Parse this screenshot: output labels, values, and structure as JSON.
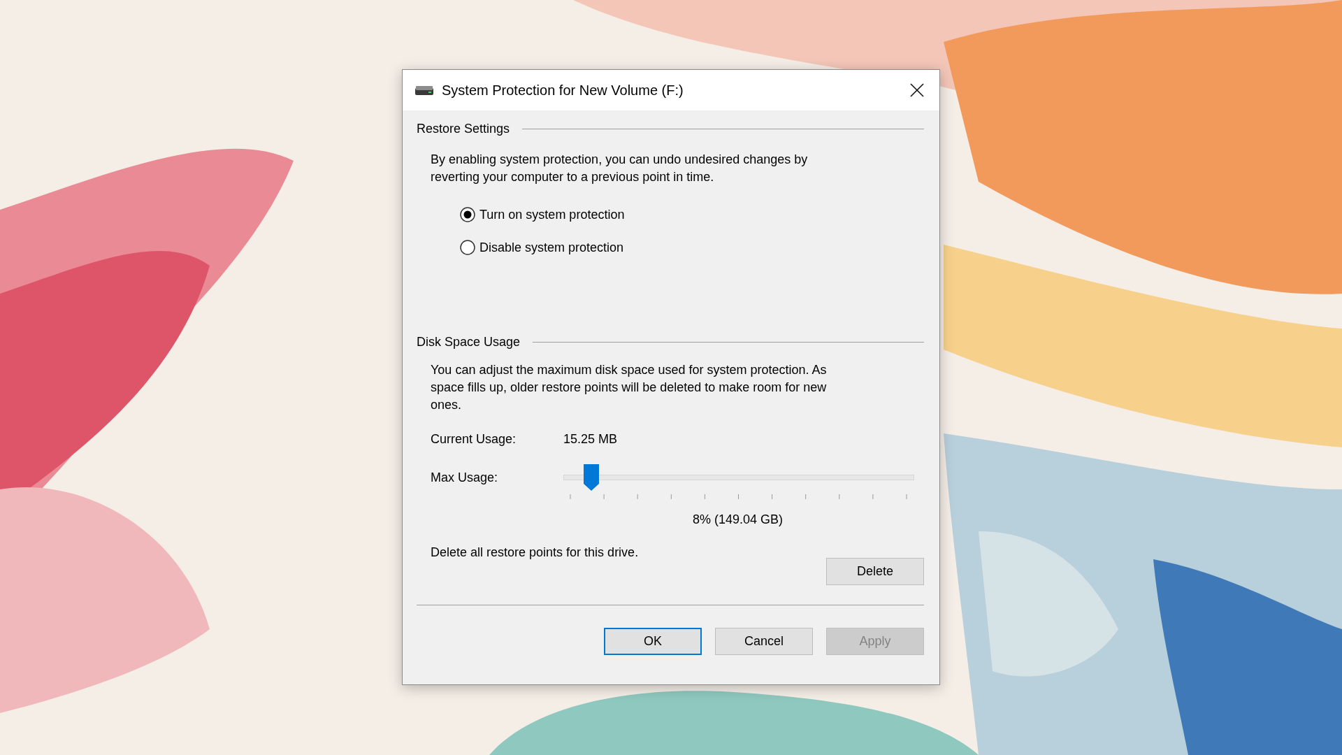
{
  "window": {
    "title": "System Protection for New Volume (F:)"
  },
  "restore_settings": {
    "heading": "Restore Settings",
    "description": "By enabling system protection, you can undo undesired changes by reverting your computer to a previous point in time.",
    "options": [
      {
        "label": "Turn on system protection",
        "selected": true
      },
      {
        "label": "Disable system protection",
        "selected": false
      }
    ]
  },
  "disk_space_usage": {
    "heading": "Disk Space Usage",
    "description": "You can adjust the maximum disk space used for system protection. As space fills up, older restore points will be deleted to make room for new ones.",
    "current_usage_label": "Current Usage:",
    "current_usage_value": "15.25 MB",
    "max_usage_label": "Max Usage:",
    "max_usage": {
      "level": 0.08
    },
    "max_usage_reading": "8% (149.04 GB)",
    "delete_text": "Delete all restore points for this drive.",
    "delete_button": "Delete"
  },
  "buttons": [
    {
      "label": "OK",
      "default": true,
      "disabled": false
    },
    {
      "label": "Cancel",
      "default": false,
      "disabled": false
    },
    {
      "label": "Apply",
      "default": false,
      "disabled": true
    }
  ]
}
